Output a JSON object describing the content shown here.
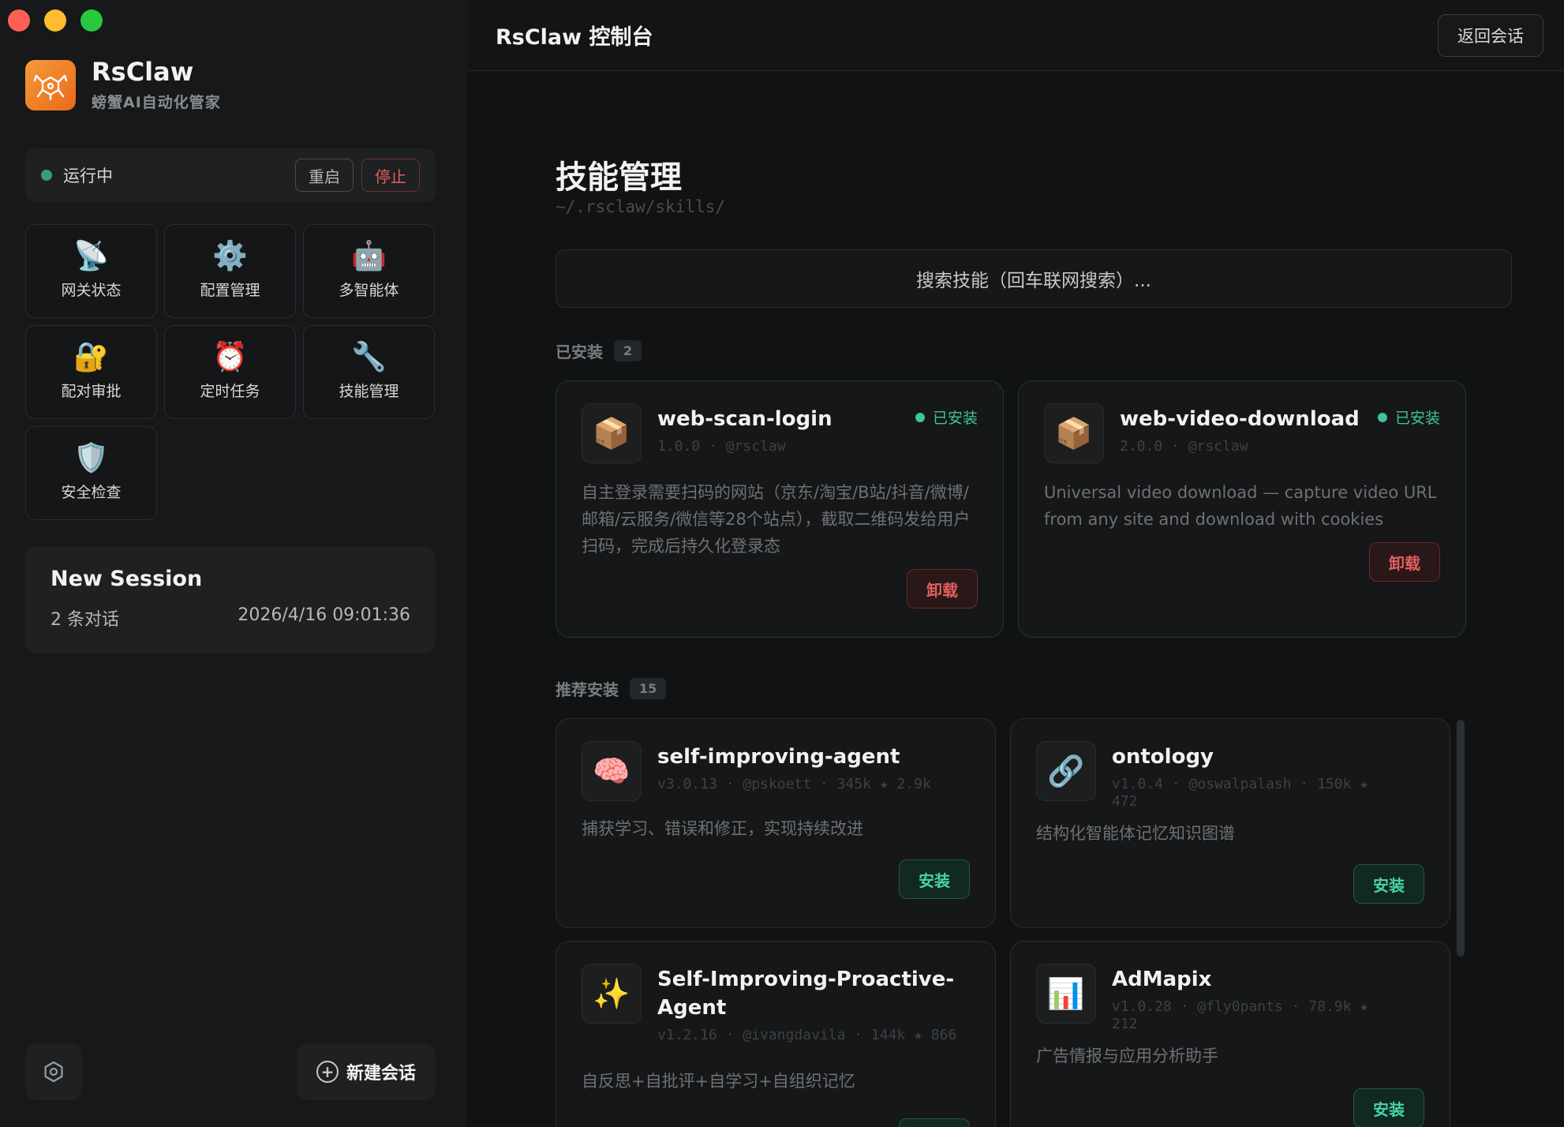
{
  "app": {
    "brand_name": "RsClaw",
    "brand_sub": "螃蟹AI自动化管家",
    "title": "RsClaw 控制台",
    "back_label": "返回会话"
  },
  "status": {
    "text": "运行中",
    "restart_label": "重启",
    "stop_label": "停止",
    "color": "#3a9a7a"
  },
  "nav": [
    {
      "label": "网关状态",
      "icon": "satellite-dish-icon",
      "glyph": "📡"
    },
    {
      "label": "配置管理",
      "icon": "gear-icon",
      "glyph": "⚙️"
    },
    {
      "label": "多智能体",
      "icon": "robot-icon",
      "glyph": "🤖"
    },
    {
      "label": "配对审批",
      "icon": "lock-key-icon",
      "glyph": "🔐"
    },
    {
      "label": "定时任务",
      "icon": "alarm-clock-icon",
      "glyph": "⏰"
    },
    {
      "label": "技能管理",
      "icon": "wrench-icon",
      "glyph": "🔧"
    },
    {
      "label": "安全检查",
      "icon": "shield-icon",
      "glyph": "🛡️"
    }
  ],
  "session": {
    "title": "New Session",
    "count": "2 条对话",
    "time": "2026/4/16 09:01:36"
  },
  "footer": {
    "new_session_label": "新建会话"
  },
  "page": {
    "title": "技能管理",
    "path": "~/.rsclaw/skills/",
    "search_placeholder": "搜索技能（回车联网搜索）..."
  },
  "installed": {
    "label": "已安装",
    "count": "2",
    "items": [
      {
        "name": "web-scan-login",
        "meta": "1.0.0 · @rsclaw",
        "desc": "自主登录需要扫码的网站（京东/淘宝/B站/抖音/微博/邮箱/云服务/微信等28个站点），截取二维码发给用户扫码，完成后持久化登录态",
        "badge": "已安装",
        "action": "卸载",
        "glyph": "📦"
      },
      {
        "name": "web-video-download",
        "meta": "2.0.0 · @rsclaw",
        "desc": "Universal video download — capture video URL from any site and download with cookies",
        "badge": "已安装",
        "action": "卸载",
        "glyph": "📦"
      }
    ]
  },
  "recommended": {
    "label": "推荐安装",
    "count": "15",
    "items": [
      {
        "name": "self-improving-agent",
        "meta": "v3.0.13 · @pskoett · 345k ★ 2.9k",
        "desc": "捕获学习、错误和修正，实现持续改进",
        "action": "安装",
        "glyph": "🧠"
      },
      {
        "name": "ontology",
        "meta": "v1.0.4 · @oswalpalash · 150k ★ 472",
        "desc": "结构化智能体记忆知识图谱",
        "action": "安装",
        "glyph": "🔗"
      },
      {
        "name": "Self-Improving-Proactive-Agent",
        "meta": "v1.2.16 · @ivangdavila · 144k ★ 866",
        "desc": "自反思+自批评+自学习+自组织记忆",
        "action": "安装",
        "glyph": "✨"
      },
      {
        "name": "AdMapix",
        "meta": "v1.0.28 · @fly0pants · 78.9k ★ 212",
        "desc": "广告情报与应用分析助手",
        "action": "安装",
        "glyph": "📊"
      }
    ]
  }
}
